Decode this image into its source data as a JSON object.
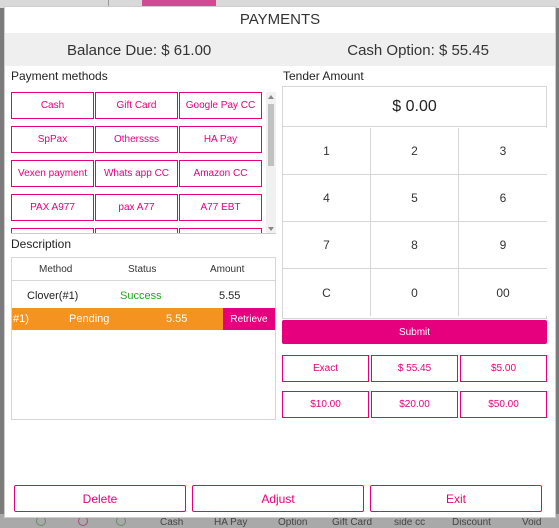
{
  "modal": {
    "title": "PAYMENTS",
    "balance_due": "Balance Due: $ 61.00",
    "cash_option": "Cash Option: $ 55.45"
  },
  "payment_methods": {
    "label": "Payment methods",
    "buttons": [
      "Cash",
      "Gift Card",
      "Google Pay CC",
      "SpPax",
      "Otherssss",
      "HA Pay",
      "Vexen payment",
      "Whats app CC",
      "Amazon CC",
      "PAX A977",
      "pax A77",
      "A77 EBT"
    ]
  },
  "description": {
    "label": "Description",
    "columns": [
      "Method",
      "Status",
      "Amount"
    ],
    "rows": [
      {
        "method": "Clover(#1)",
        "status": "Success",
        "amount": "5.55"
      },
      {
        "method": "#1)",
        "status": "Pending",
        "amount": "5.55",
        "action": "Retrieve"
      }
    ]
  },
  "tender": {
    "label": "Tender Amount",
    "display": "$ 0.00",
    "keys": [
      "1",
      "2",
      "3",
      "4",
      "5",
      "6",
      "7",
      "8",
      "9",
      "C",
      "0",
      "00"
    ],
    "submit": "Submit",
    "quick_amounts": [
      "Exact",
      "$ 55.45",
      "$5.00",
      "$10.00",
      "$20.00",
      "$50.00"
    ]
  },
  "footer": {
    "delete": "Delete",
    "adjust": "Adjust",
    "exit": "Exit"
  },
  "background": {
    "bottom_items": [
      "Cash",
      "HA Pay",
      "Option",
      "Gift Card",
      "side cc",
      "Discount",
      "Void"
    ]
  },
  "colors": {
    "accent": "#e6007e",
    "pending": "#f59320",
    "success": "#1fa61f"
  }
}
